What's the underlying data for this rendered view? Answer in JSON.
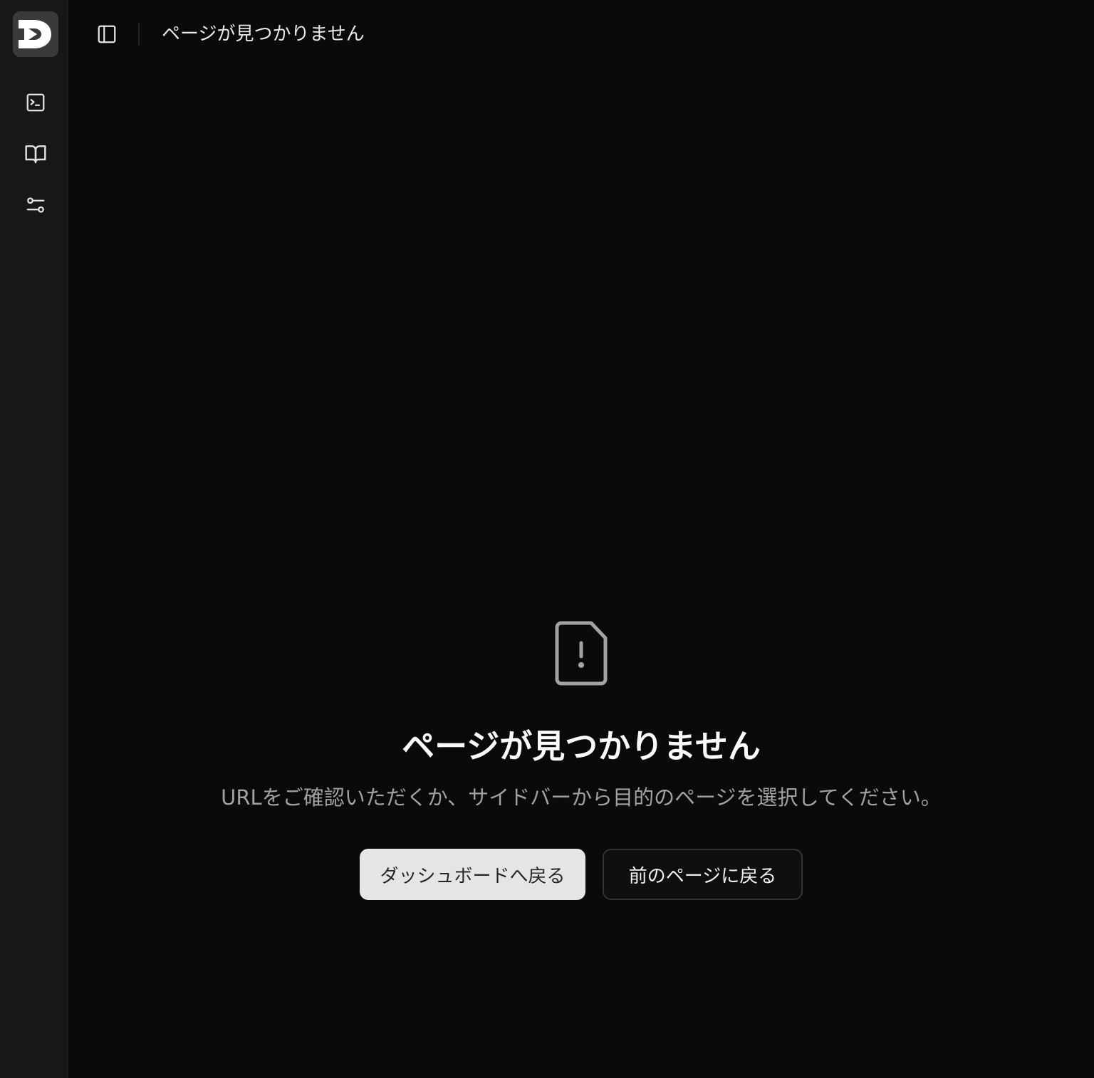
{
  "header": {
    "title": "ページが見つかりません"
  },
  "sidebar": {
    "logo_letter": "D",
    "items": [
      {
        "icon": "terminal-icon"
      },
      {
        "icon": "book-open-icon"
      },
      {
        "icon": "sliders-icon"
      }
    ]
  },
  "empty_state": {
    "icon": "file-alert-icon",
    "title": "ページが見つかりません",
    "description": "URLをご確認いただくか、サイドバーから目的のページを選択してください。",
    "primary_button": "ダッシュボードへ戻る",
    "secondary_button": "前のページに戻る"
  },
  "colors": {
    "background": "#0a0a0a",
    "sidebar": "#171717",
    "primary_button_bg": "#e5e5e5",
    "muted_text": "#a1a1a1"
  }
}
